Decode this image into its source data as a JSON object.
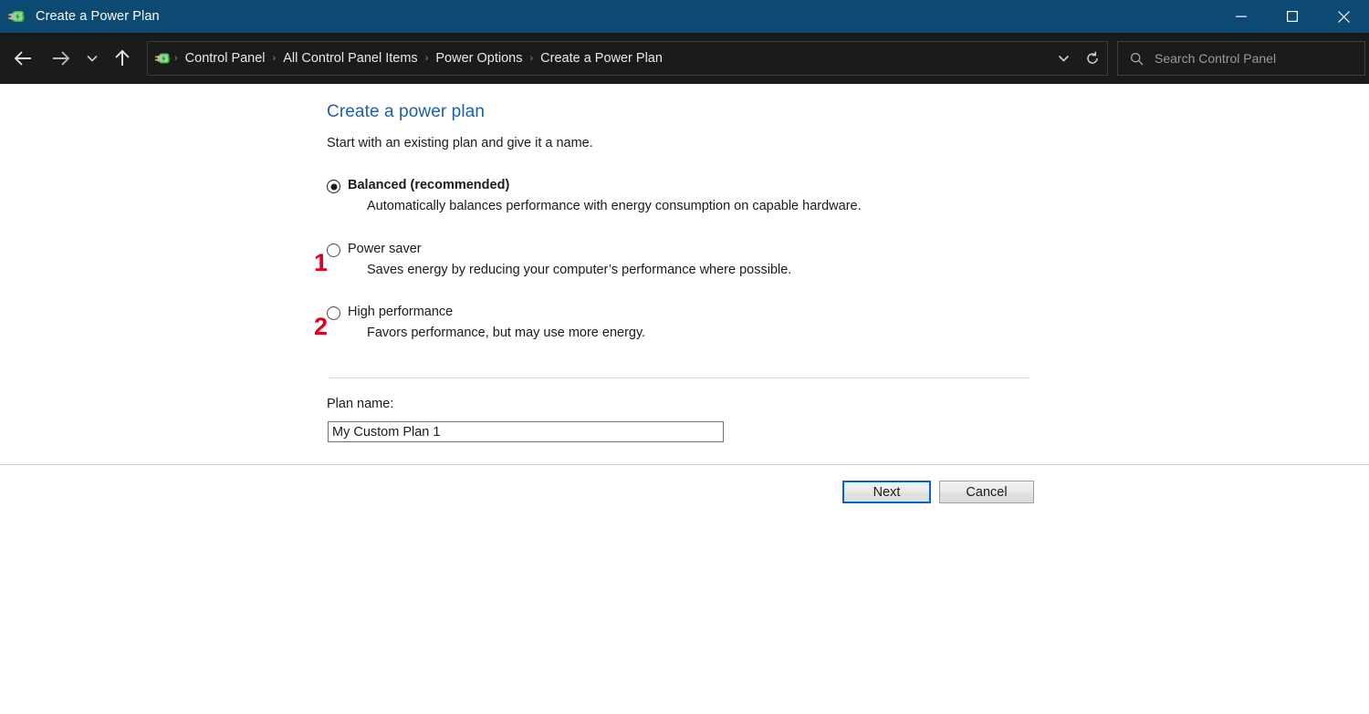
{
  "window": {
    "title": "Create a Power Plan",
    "app_icon": "power-plan-icon",
    "controls": {
      "minimize": "minimize-icon",
      "maximize": "maximize-icon",
      "close": "close-icon"
    },
    "titlebar_color": "#0c4a74",
    "navbar_color": "#1b1b1b"
  },
  "nav": {
    "back": "back-arrow-icon",
    "forward": "forward-arrow-icon",
    "recent": "recent-locations-chevron-icon",
    "up": "up-arrow-icon",
    "breadcrumb_icon": "power-plan-icon",
    "breadcrumb": [
      "Control Panel",
      "All Control Panel Items",
      "Power Options",
      "Create a Power Plan"
    ],
    "separator": "›",
    "history_dropdown": "chevron-down-icon",
    "refresh": "refresh-icon"
  },
  "search": {
    "icon": "search-icon",
    "placeholder": "Search Control Panel",
    "value": ""
  },
  "main": {
    "heading": "Create a power plan",
    "heading_color": "#1d5fa8",
    "subtitle": "Start with an existing plan and give it a name.",
    "options": [
      {
        "label": "Balanced (recommended)",
        "description": "Automatically balances performance with energy consumption on capable hardware.",
        "selected": true,
        "annotation": "1"
      },
      {
        "label": "Power saver",
        "description": "Saves energy by reducing your computer’s performance where possible.",
        "selected": false,
        "annotation": "2"
      },
      {
        "label": "High performance",
        "description": "Favors performance, but may use more energy.",
        "selected": false,
        "annotation": ""
      }
    ],
    "plan_name_label": "Plan name:",
    "plan_name_value": "My Custom Plan 1",
    "plan_name_placeholder": ""
  },
  "footer": {
    "next_label": "Next",
    "cancel_label": "Cancel",
    "focus_color": "#0a64c8"
  },
  "annotation_color": "#e00020"
}
